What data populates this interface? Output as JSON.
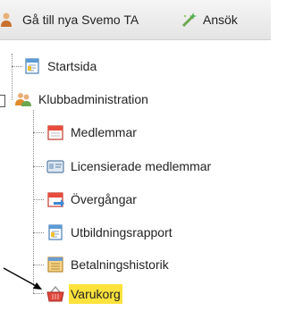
{
  "toolbar": {
    "item1_label": "Gå till nya Svemo TA",
    "item2_label": "Ansök"
  },
  "tree": {
    "items": [
      {
        "label": "Startsida",
        "icon": "page-icon"
      },
      {
        "label": "Klubbadministration",
        "icon": "people-icon"
      },
      {
        "label": "Medlemmar",
        "icon": "calendar-icon"
      },
      {
        "label": "Licensierade medlemmar",
        "icon": "card-icon"
      },
      {
        "label": "Övergångar",
        "icon": "calendar-arrow-icon"
      },
      {
        "label": "Utbildningsrapport",
        "icon": "page-icon"
      },
      {
        "label": "Betalningshistorik",
        "icon": "ledger-icon"
      },
      {
        "label": "Varukorg",
        "icon": "basket-icon",
        "selected": true
      }
    ]
  },
  "colors": {
    "selection": "#fde23c",
    "toolbar": "#ebebeb"
  }
}
